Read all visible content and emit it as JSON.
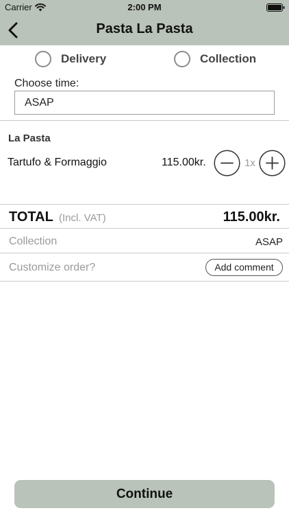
{
  "status_bar": {
    "carrier": "Carrier",
    "time": "2:00 PM",
    "wifi_icon": "wifi-icon",
    "battery_icon": "battery-icon"
  },
  "nav": {
    "back_icon": "chevron-left-icon",
    "title": "Pasta La Pasta"
  },
  "order_type": {
    "options": [
      {
        "label": "Delivery",
        "selected": false
      },
      {
        "label": "Collection",
        "selected": false
      }
    ]
  },
  "time": {
    "label": "Choose time:",
    "value": "ASAP"
  },
  "cart": {
    "restaurant": "La Pasta",
    "items": [
      {
        "name": "Tartufo & Formaggio",
        "price": "115.00kr.",
        "quantity": "1x",
        "minus_icon": "minus-circle-icon",
        "plus_icon": "plus-circle-icon"
      }
    ]
  },
  "summary": {
    "total_label": "TOTAL",
    "total_note": "(Incl. VAT)",
    "total_value": "115.00kr.",
    "method_label": "Collection",
    "method_value": "ASAP",
    "customize_label": "Customize order?",
    "comment_button": "Add comment"
  },
  "footer": {
    "continue_label": "Continue"
  },
  "colors": {
    "accent": "#b9c3b9",
    "muted_text": "#9a9a9a",
    "divider": "#c9c9c9"
  }
}
